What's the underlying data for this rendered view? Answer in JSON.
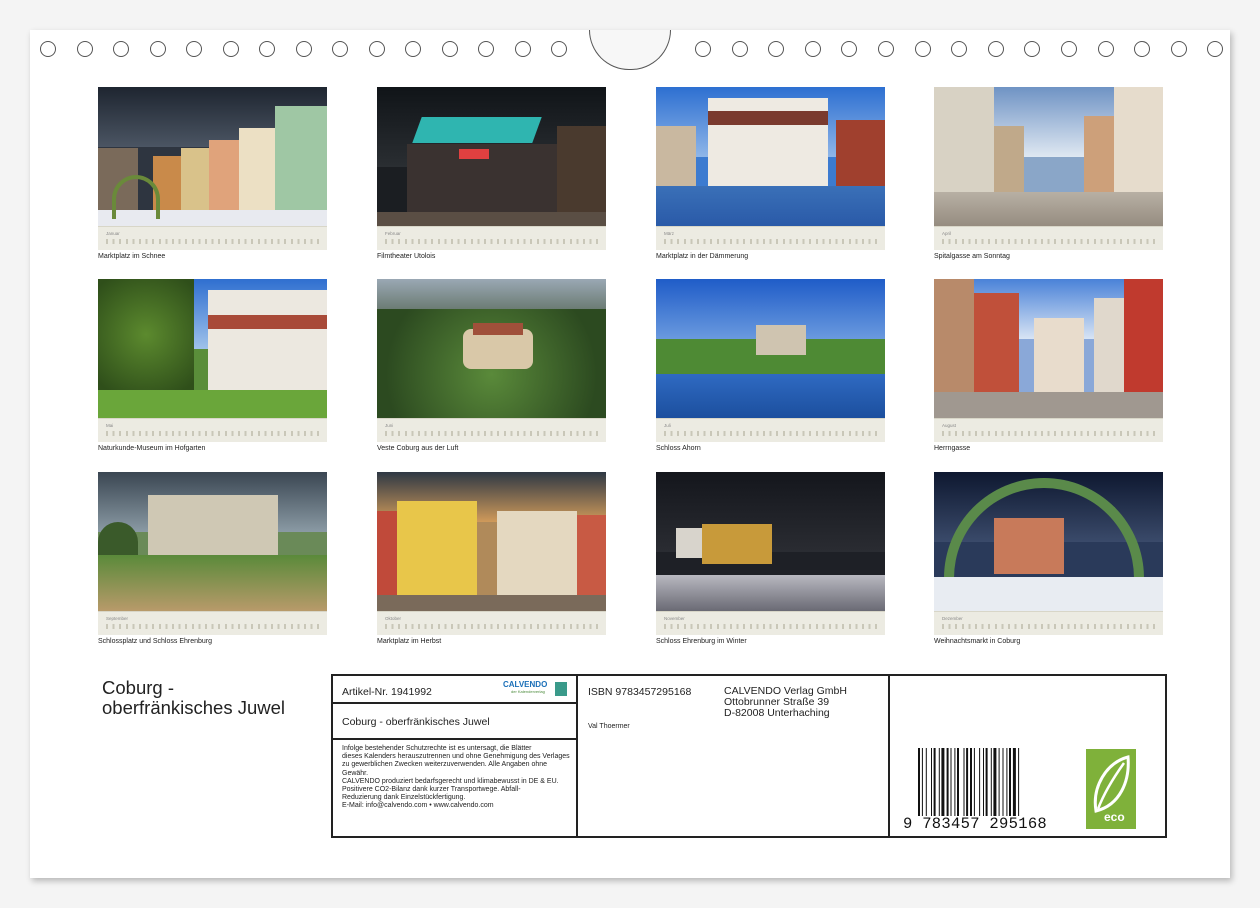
{
  "months": [
    {
      "month": "Januar",
      "caption": "Marktplatz im Schnee"
    },
    {
      "month": "Februar",
      "caption": "Filmtheater Utolois"
    },
    {
      "month": "März",
      "caption": "Marktplatz in der Dämmerung"
    },
    {
      "month": "April",
      "caption": "Spitalgasse am Sonntag"
    },
    {
      "month": "Mai",
      "caption": "Naturkunde-Museum im Hofgarten"
    },
    {
      "month": "Juni",
      "caption": "Veste Coburg aus der Luft"
    },
    {
      "month": "Juli",
      "caption": "Schloss Ahorn"
    },
    {
      "month": "August",
      "caption": "Herrngasse"
    },
    {
      "month": "September",
      "caption": "Schlossplatz und Schloss Ehrenburg"
    },
    {
      "month": "Oktober",
      "caption": "Marktplatz im Herbst"
    },
    {
      "month": "November",
      "caption": "Schloss Ehrenburg im Winter"
    },
    {
      "month": "Dezember",
      "caption": "Weihnachtsmarkt in Coburg"
    }
  ],
  "title": {
    "line1": "Coburg -",
    "line2": "oberfränkisches Juwel"
  },
  "info": {
    "article": "Artikel-Nr. 1941992",
    "brand": "CALVENDO",
    "brand_sub": "der Kalenderverlag",
    "calendar_title": "Coburg - oberfränkisches Juwel",
    "legal": [
      "Infolge bestehender Schutzrechte ist es untersagt, die Blätter",
      "dieses Kalenders herauszutrennen und ohne Genehmigung des Verlages",
      "zu gewerblichen Zwecken weiterzuverwenden. Alle Angaben ohne",
      "Gewähr.",
      "CALVENDO produziert bedarfsgerecht und klimabewusst in DE & EU.",
      "Positivere CO2-Bilanz dank kurzer Transportwege. Abfall-",
      "Reduzierung dank Einzelstückfertigung.",
      "E-Mail: info@calvendo.com • www.calvendo.com"
    ],
    "isbn": "ISBN 9783457295168",
    "author": "Val Thoermer",
    "publisher": [
      "CALVENDO Verlag GmbH",
      "Ottobrunner Straße 39",
      "D-82008 Unterhaching"
    ],
    "barcode_number": "9 783457 295168",
    "eco_label": "eco"
  }
}
